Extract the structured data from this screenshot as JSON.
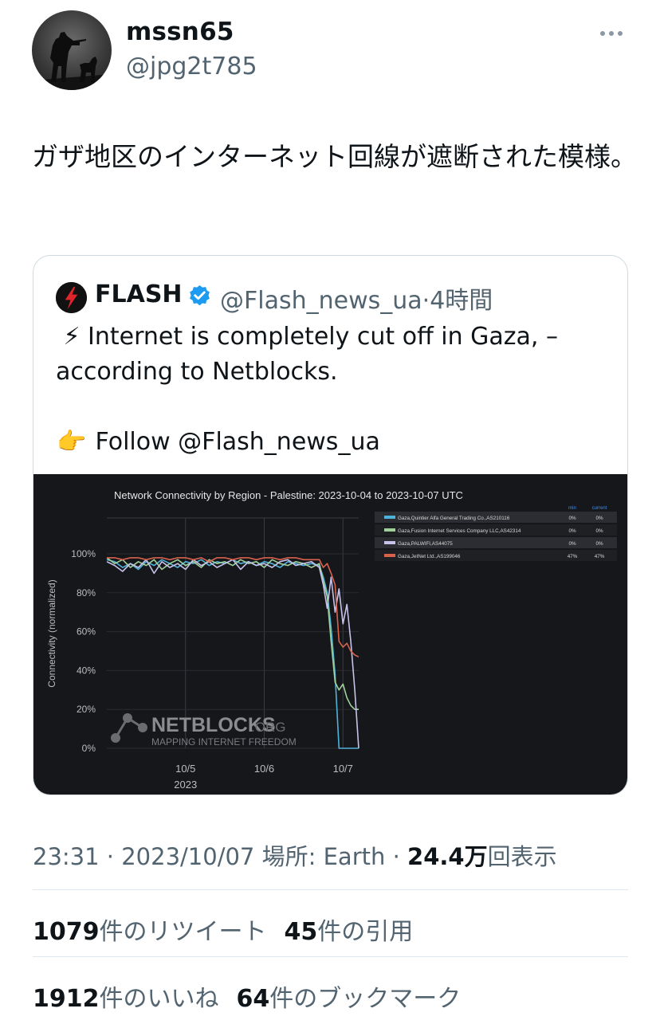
{
  "author": {
    "display_name": "mssn65",
    "handle": "@jpg2t785"
  },
  "tweet": {
    "text": "ガザ地区のインターネット回線が遮断された模様。"
  },
  "quote": {
    "name": "FLASH",
    "handle": "@Flash_news_ua",
    "time": "4時間",
    "line1_emoji": "⚡",
    "line1": "Internet is completely cut off in Gaza, – according to Netblocks.",
    "follow_emoji": "👉",
    "follow_text": "Follow @Flash_news_ua"
  },
  "chart_data": {
    "type": "line",
    "title": "Network Connectivity by Region - Palestine: 2023-10-04 to 2023-10-07 UTC",
    "ylabel": "Connectivity (normalized)",
    "y_ticks": [
      "100%",
      "80%",
      "60%",
      "40%",
      "20%",
      "0%"
    ],
    "x_ticks": [
      "10/5",
      "10/6",
      "10/7"
    ],
    "x_year": "2023",
    "x": [
      0,
      0.1,
      0.2,
      0.3,
      0.4,
      0.5,
      0.6,
      0.7,
      0.8,
      0.9,
      1.0,
      1.1,
      1.2,
      1.3,
      1.4,
      1.5,
      1.6,
      1.7,
      1.8,
      1.9,
      2.0,
      2.1,
      2.2,
      2.3,
      2.4,
      2.5,
      2.6,
      2.7,
      2.75,
      2.8,
      2.85,
      2.9,
      2.95,
      3.0,
      3.05,
      3.1,
      3.15,
      3.2
    ],
    "ylim": [
      0,
      100
    ],
    "legend_header": [
      "min",
      "current"
    ],
    "series": [
      {
        "name": "Gaza,Quintier Alfa General Trading Co.,AS210116",
        "min": "0%",
        "current": "0%",
        "color": "#4fb3d9",
        "values": [
          97,
          96,
          93,
          95,
          92,
          96,
          94,
          97,
          95,
          93,
          96,
          95,
          97,
          94,
          96,
          95,
          97,
          95,
          96,
          94,
          96,
          95,
          93,
          96,
          95,
          94,
          95,
          94,
          88,
          80,
          62,
          38,
          0,
          0,
          0,
          0,
          0,
          0
        ]
      },
      {
        "name": "Gaza,Fusion Internet Services Company LLC,AS42314",
        "min": "0%",
        "current": "0%",
        "color": "#9fd19a",
        "values": [
          98,
          95,
          97,
          93,
          96,
          94,
          97,
          92,
          95,
          97,
          94,
          96,
          93,
          97,
          95,
          96,
          94,
          97,
          95,
          96,
          93,
          97,
          95,
          94,
          96,
          95,
          93,
          95,
          86,
          78,
          55,
          34,
          30,
          33,
          26,
          22,
          20,
          20
        ]
      },
      {
        "name": "Gaza,PALWIFI,AS44075",
        "min": "0%",
        "current": "0%",
        "color": "#c6c2ea",
        "values": [
          96,
          94,
          91,
          95,
          93,
          97,
          90,
          96,
          93,
          95,
          92,
          97,
          94,
          96,
          93,
          95,
          97,
          92,
          96,
          94,
          95,
          93,
          96,
          97,
          94,
          95,
          96,
          93,
          84,
          72,
          88,
          70,
          82,
          64,
          74,
          55,
          30,
          0
        ]
      },
      {
        "name": "Gaza,JetNet Ltd.,AS199046",
        "min": "47%",
        "current": "47%",
        "color": "#d9624d",
        "values": [
          98,
          98,
          97,
          98,
          98,
          97,
          98,
          98,
          97,
          98,
          98,
          97,
          98,
          96,
          98,
          98,
          97,
          98,
          98,
          97,
          98,
          98,
          97,
          98,
          98,
          97,
          97,
          97,
          93,
          95,
          90,
          84,
          55,
          52,
          54,
          50,
          48,
          47
        ]
      }
    ],
    "watermark": {
      "brand": "NETBLOCKS",
      "brand_suffix": ".ORG",
      "tagline": "MAPPING INTERNET FREEDOM"
    }
  },
  "meta": {
    "time": "23:31",
    "date": "2023/10/07",
    "place_label": "場所: Earth",
    "views_value": "24.4万",
    "views_label": "回表示"
  },
  "stats": {
    "retweets_value": "1079",
    "retweets_label": "件のリツイート",
    "quotes_value": "45",
    "quotes_label": "件の引用",
    "likes_value": "1912",
    "likes_label": "件のいいね",
    "bookmarks_value": "64",
    "bookmarks_label": "件のブックマーク"
  },
  "colors": {
    "accent": "#1d9bf0",
    "muted": "#536471",
    "chart_bg": "#16171b"
  },
  "icons": [
    "more-icon",
    "verified-icon",
    "lightning-icon"
  ]
}
